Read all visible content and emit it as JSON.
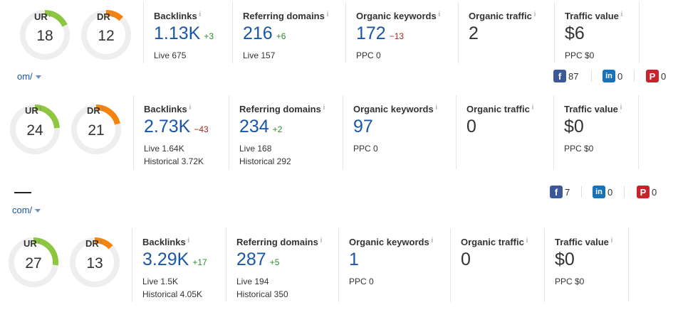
{
  "rows": [
    {
      "ur": {
        "label": "UR",
        "value": "18",
        "fraction": 0.18
      },
      "dr": {
        "label": "DR",
        "value": "12",
        "fraction": 0.12
      },
      "backlinks": {
        "title": "Backlinks",
        "value": "1.13K",
        "delta": "+3",
        "live": "Live 675"
      },
      "referring": {
        "title": "Referring domains",
        "value": "216",
        "delta": "+6",
        "live": "Live 157"
      },
      "keywords": {
        "title": "Organic keywords",
        "value": "172",
        "delta": "−13",
        "ppc": "PPC 0"
      },
      "traffic": {
        "title": "Organic traffic",
        "value": "2"
      },
      "traffic_value": {
        "title": "Traffic value",
        "value": "$6",
        "ppc": "PPC $0"
      }
    },
    {
      "ur": {
        "label": "UR",
        "value": "24",
        "fraction": 0.24
      },
      "dr": {
        "label": "DR",
        "value": "21",
        "fraction": 0.21
      },
      "backlinks": {
        "title": "Backlinks",
        "value": "2.73K",
        "delta": "−43",
        "live": "Live 1.64K",
        "historical": "Historical 3.72K"
      },
      "referring": {
        "title": "Referring domains",
        "value": "234",
        "delta": "+2",
        "live": "Live 168",
        "historical": "Historical 292"
      },
      "keywords": {
        "title": "Organic keywords",
        "value": "97",
        "ppc": "PPC 0"
      },
      "traffic": {
        "title": "Organic traffic",
        "value": "0"
      },
      "traffic_value": {
        "title": "Traffic value",
        "value": "$0",
        "ppc": "PPC $0"
      }
    },
    {
      "ur": {
        "label": "UR",
        "value": "27",
        "fraction": 0.27
      },
      "dr": {
        "label": "DR",
        "value": "13",
        "fraction": 0.13
      },
      "backlinks": {
        "title": "Backlinks",
        "value": "3.29K",
        "delta": "+17",
        "live": "Live 1.5K",
        "historical": "Historical 4.05K"
      },
      "referring": {
        "title": "Referring domains",
        "value": "287",
        "delta": "+5",
        "live": "Live 194",
        "historical": "Historical 350"
      },
      "keywords": {
        "title": "Organic keywords",
        "value": "1",
        "ppc": "PPC 0"
      },
      "traffic": {
        "title": "Organic traffic",
        "value": "0"
      },
      "traffic_value": {
        "title": "Traffic value",
        "value": "$0",
        "ppc": "PPC $0"
      }
    }
  ],
  "info_glyph": "i",
  "urls": [
    "om/",
    "com/"
  ],
  "social": [
    {
      "facebook_glyph": "f",
      "facebook": "87",
      "linkedin_glyph": "in",
      "linkedin": "0",
      "pinterest_glyph": "P",
      "pinterest": "0"
    },
    {
      "facebook_glyph": "f",
      "facebook": "7",
      "linkedin_glyph": "in",
      "linkedin": "0",
      "pinterest_glyph": "P",
      "pinterest": "0"
    }
  ],
  "colors": {
    "ur": "#8dc63f",
    "dr": "#f7830f",
    "track": "#eeeeee",
    "link": "#1a56a8",
    "up": "#2e8b2e",
    "down": "#b22222"
  }
}
